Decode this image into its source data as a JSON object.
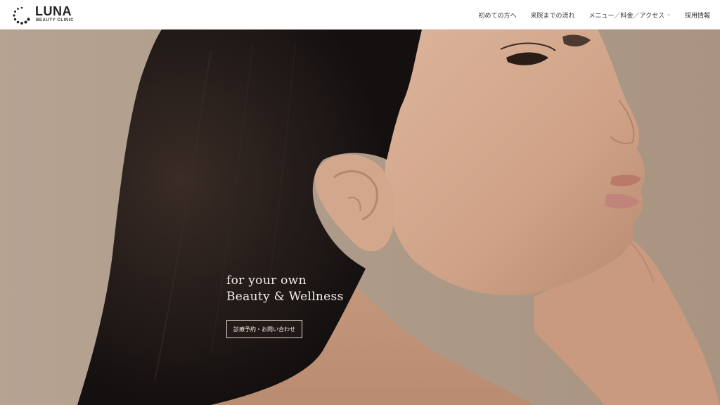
{
  "header": {
    "logo": {
      "name": "LUNA",
      "sub": "BEAUTY CLINIC"
    },
    "nav": [
      {
        "label": "初めての方へ"
      },
      {
        "label": "来院までの流れ"
      },
      {
        "label": "メニュー／料金／アクセス",
        "has_dropdown": true
      },
      {
        "label": "採用情報"
      }
    ]
  },
  "hero": {
    "tagline_line1": "for your own",
    "tagline_line2": "Beauty & Wellness",
    "cta_label": "診療予約・お問い合わせ"
  },
  "colors": {
    "header_bg": "#ffffff",
    "hero_bg": "#b09c8b",
    "hair": "#1a1412",
    "skin": "#d2a88e",
    "text_light": "#f3ede8"
  },
  "icons": {
    "logo_mark": "dotted-circle-logo-icon",
    "dropdown": "chevron-down-icon"
  }
}
